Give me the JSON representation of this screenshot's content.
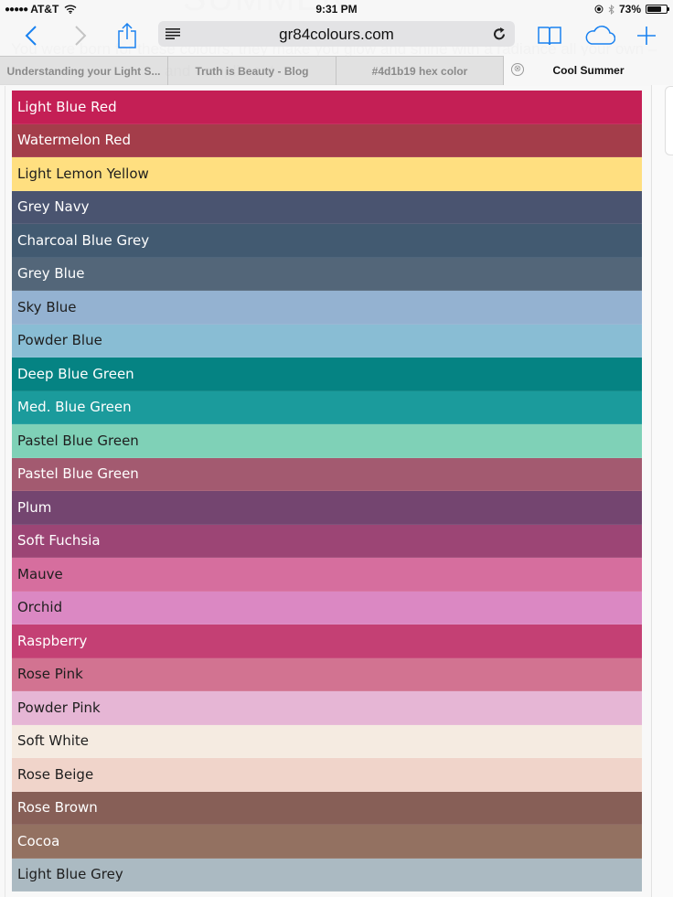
{
  "status_bar": {
    "carrier": "AT&T",
    "signal_dots": "●●●●●",
    "time": "9:31 PM",
    "battery_percent": "73%",
    "battery_level": 0.73
  },
  "toolbar": {
    "url": "gr84colours.com",
    "icons": {
      "back": "chevron-left-icon",
      "forward": "chevron-right-icon",
      "share": "share-icon",
      "reader": "reader-icon",
      "reload": "reload-icon",
      "bookmarks": "book-icon",
      "icloud_tabs": "cloud-icon",
      "new_tab": "plus-icon"
    }
  },
  "ghost_page_text": {
    "heading": "SUMMER",
    "line1": "You were born for these colours, they make you glow and shine with a radiance all your own –",
    "line2": "and compliment"
  },
  "tabs": [
    {
      "label": "Understanding your Light S...",
      "active": false
    },
    {
      "label": "Truth is Beauty - Blog",
      "active": false
    },
    {
      "label": "#4d1b19 hex color",
      "active": false
    },
    {
      "label": "Cool Summer",
      "active": true,
      "close_icon": "⊗"
    }
  ],
  "swatches": [
    {
      "name": "Light Blue Red",
      "color": "#c41f55",
      "text": "light"
    },
    {
      "name": "Watermelon Red",
      "color": "#a43d4a",
      "text": "light"
    },
    {
      "name": "Light Lemon Yellow",
      "color": "#ffdf80",
      "text": "dark"
    },
    {
      "name": "Grey Navy",
      "color": "#4a5470",
      "text": "light"
    },
    {
      "name": "Charcoal Blue Grey",
      "color": "#425a71",
      "text": "light"
    },
    {
      "name": "Grey Blue",
      "color": "#536679",
      "text": "light"
    },
    {
      "name": "Sky Blue",
      "color": "#94b2d1",
      "text": "dark"
    },
    {
      "name": "Powder Blue",
      "color": "#89bdd4",
      "text": "dark"
    },
    {
      "name": "Deep Blue Green",
      "color": "#058383",
      "text": "light"
    },
    {
      "name": "Med. Blue Green",
      "color": "#1b9b9c",
      "text": "light"
    },
    {
      "name": "Pastel Blue Green",
      "color": "#7fd1b7",
      "text": "dark"
    },
    {
      "name": "Pastel Blue Green",
      "color": "#a35a70",
      "text": "light"
    },
    {
      "name": "Plum",
      "color": "#744570",
      "text": "light"
    },
    {
      "name": "Soft Fuchsia",
      "color": "#9c4575",
      "text": "light"
    },
    {
      "name": "Mauve",
      "color": "#d66e9e",
      "text": "dark"
    },
    {
      "name": "Orchid",
      "color": "#db88c3",
      "text": "dark"
    },
    {
      "name": "Raspberry",
      "color": "#c44074",
      "text": "light"
    },
    {
      "name": "Rose Pink",
      "color": "#d27391",
      "text": "dark"
    },
    {
      "name": "Powder Pink",
      "color": "#e6b6d5",
      "text": "dark"
    },
    {
      "name": "Soft White",
      "color": "#f5ebe1",
      "text": "dark"
    },
    {
      "name": "Rose Beige",
      "color": "#f0d4ca",
      "text": "dark"
    },
    {
      "name": "Rose Brown",
      "color": "#875f57",
      "text": "light"
    },
    {
      "name": "Cocoa",
      "color": "#937161",
      "text": "light"
    },
    {
      "name": "Light Blue Grey",
      "color": "#abbac2",
      "text": "dark"
    }
  ]
}
